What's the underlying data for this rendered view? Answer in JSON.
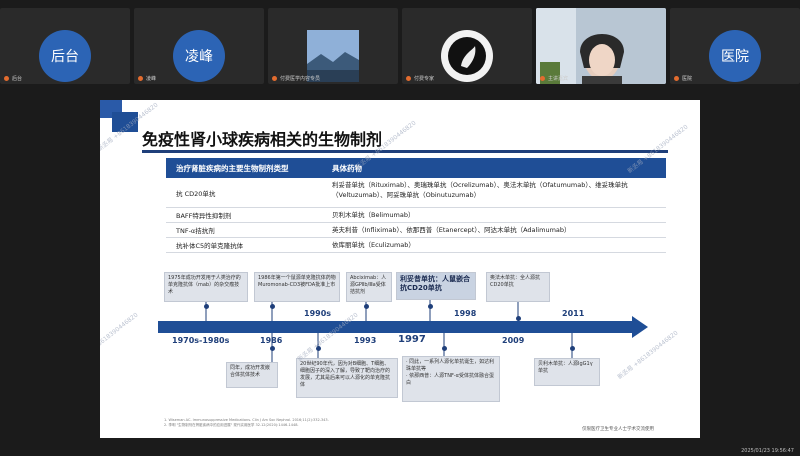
{
  "participants": [
    {
      "avatar": "后台",
      "name": "后台"
    },
    {
      "avatar": "凌峰",
      "name": "凌峰"
    },
    {
      "avatar": "",
      "name": "付费医学内容专员"
    },
    {
      "avatar": "",
      "name": "付费专家"
    },
    {
      "avatar": "",
      "name": "主讲嘉宾"
    },
    {
      "avatar": "医院",
      "name": "医院"
    }
  ],
  "slide": {
    "title": "免疫性肾小球疾病相关的生物制剂",
    "table": {
      "headers": [
        "治疗肾脏疾病的主要生物制剂类型",
        "具体药物"
      ],
      "rows": [
        {
          "type": "抗 CD20单抗",
          "drugs": "利妥昔单抗（Rituximab）、奥瑞珠单抗（Ocrelizumab）、奥法木单抗（Ofatumumab）、维妥珠单抗（Veltuzumab）、阿妥珠单抗（Obinutuzumab）"
        },
        {
          "type": "BAFF特异性抑制剂",
          "drugs": "贝利木单抗（Belimumab）"
        },
        {
          "type": "TNF-α拮抗剂",
          "drugs": "英夫利昔（Infliximab）、依那西普（Etanercept）、阿达木单抗（Adalimumab）"
        },
        {
          "type": "抗补体C5的单克隆抗体",
          "drugs": "依库丽单抗（Eculizumab）"
        }
      ]
    },
    "timeline": {
      "years": [
        "1970s-1980s",
        "1986",
        "1990s",
        "1993",
        "1997",
        "1998",
        "2009",
        "2011"
      ],
      "top_boxes": [
        "1975年成功开发用于人类治疗的单克隆抗体（mab）的杂交瘤技术",
        "1986年第一个鼠源单克隆抗体药物Muromonab-CD3被FDA批准上市",
        "Abciximab：人源GPⅡb/Ⅲa受体拮抗剂",
        "利妥昔单抗：人鼠嵌合抗CD20单抗",
        "奥法木单抗：全人源抗CD20单抗"
      ],
      "bottom_boxes": [
        "同年，成功开发嵌合体抗体技术",
        "20世纪90年代，因为对B细胞、T细胞、细胞因子的深入了解，导致了靶向治疗的发展，尤其是后来可以人源化的单克隆抗体",
        "· 同此，一系列人源化单抗诞生，如达利珠单抗等\n· 依那西普：人源TNF-α受体抗体融合蛋白",
        "贝利木单抗：人源IgG1γ单抗"
      ]
    },
    "references": [
      "1. Wiseman AC. Immunosuppressive Medications. Clin J Am Soc Nephrol. 2016;11(2):332-343.",
      "2. 李明 \"生物制剂在肾脏疾病中的应用进展\" 现代实用医学 32.12(2020):1446-1448."
    ],
    "footer": "仅限医疗卫生专业人士学术交流使用",
    "watermark": "新丞易 +8618390446820"
  },
  "clock": "2025/01/23 19:56:47",
  "colors": {
    "accent": "#1f4e96",
    "avatar": "#2c64b5"
  }
}
